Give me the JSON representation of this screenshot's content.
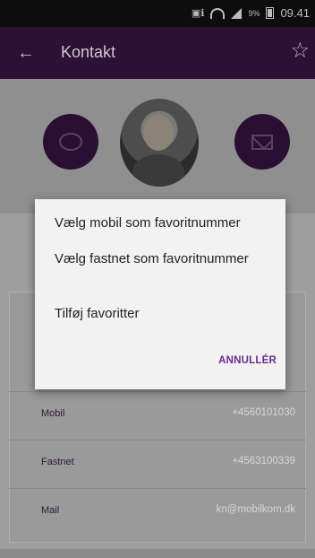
{
  "status_bar": {
    "time": "09.41",
    "battery_percent": "9%",
    "icons": [
      "mute-icon",
      "wifi-icon",
      "signal-icon",
      "battery-icon"
    ]
  },
  "toolbar": {
    "title": "Kontakt",
    "back_icon": "arrow-left-icon",
    "favorite_icon": "star-outline-icon"
  },
  "contact_actions": {
    "message_icon": "chat-bubble-icon",
    "mail_icon": "envelope-icon"
  },
  "details": [
    {
      "label": "Mobil",
      "value": "+4560101030"
    },
    {
      "label": "Fastnet",
      "value": "+4563100339"
    },
    {
      "label": "Mail",
      "value": "kn@mobilkom.dk"
    }
  ],
  "dialog": {
    "options": [
      "Vælg mobil som favoritnummer",
      "Vælg fastnet som favoritnummer",
      "Tilføj favoritter"
    ],
    "cancel_label": "ANNULLÉR"
  },
  "colors": {
    "toolbar": "#2c1135",
    "action_circle": "#2a0f33",
    "dialog_accent": "#6a2c8e",
    "scrim": "#9e9e9e"
  }
}
